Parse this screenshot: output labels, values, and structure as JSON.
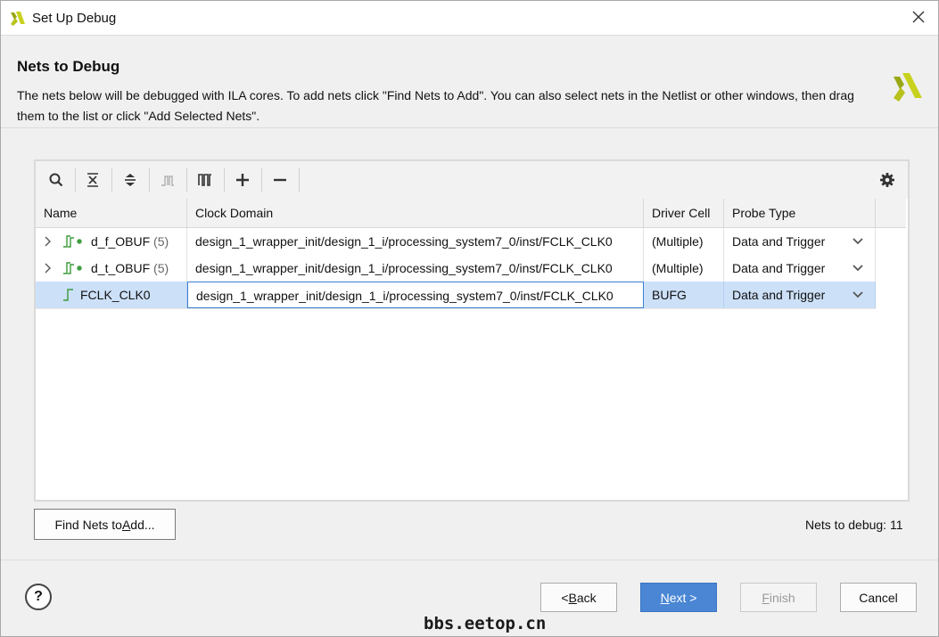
{
  "window": {
    "title": "Set Up Debug"
  },
  "header": {
    "title": "Nets to Debug",
    "description": "The nets below will be debugged with ILA cores. To add nets click \"Find Nets to Add\". You can also select nets in the Netlist or other windows, then drag them to the list or click \"Add Selected Nets\"."
  },
  "toolbar": {
    "buttons": [
      "search-icon",
      "collapse-all-icon",
      "expand-all-icon",
      "signal-icon",
      "waveform-icon",
      "add-icon",
      "remove-icon"
    ],
    "settings_icon": "gear-icon"
  },
  "table": {
    "columns": [
      "Name",
      "Clock Domain",
      "Driver Cell",
      "Probe Type"
    ],
    "rows": [
      {
        "name": "d_f_OBUF",
        "count": "(5)",
        "clock_domain": "design_1_wrapper_init/design_1_i/processing_system7_0/inst/FCLK_CLK0",
        "driver_cell": "(Multiple)",
        "probe_type": "Data and Trigger",
        "expandable": true,
        "selected": false
      },
      {
        "name": "d_t_OBUF",
        "count": "(5)",
        "clock_domain": "design_1_wrapper_init/design_1_i/processing_system7_0/inst/FCLK_CLK0",
        "driver_cell": "(Multiple)",
        "probe_type": "Data and Trigger",
        "expandable": true,
        "selected": false
      },
      {
        "name": "FCLK_CLK0",
        "count": "",
        "clock_domain": "design_1_wrapper_init/design_1_i/processing_system7_0/inst/FCLK_CLK0",
        "driver_cell": "BUFG",
        "probe_type": "Data and Trigger",
        "expandable": false,
        "selected": true
      }
    ]
  },
  "find_button": {
    "pre": "Find Nets to ",
    "ul": "A",
    "post": "dd..."
  },
  "status": {
    "nets_to_debug": "Nets to debug: 11"
  },
  "footer": {
    "help": "?",
    "back": {
      "pre": "< ",
      "ul": "B",
      "post": "ack"
    },
    "next": {
      "pre": "",
      "ul": "N",
      "post": "ext >"
    },
    "finish": {
      "pre": "",
      "ul": "F",
      "post": "inish"
    },
    "cancel": "Cancel"
  },
  "watermark": "bbs.eetop.cn",
  "colors": {
    "accent": "#4a86d4",
    "selection": "#cce0f8",
    "logo": "#c8d21e"
  }
}
